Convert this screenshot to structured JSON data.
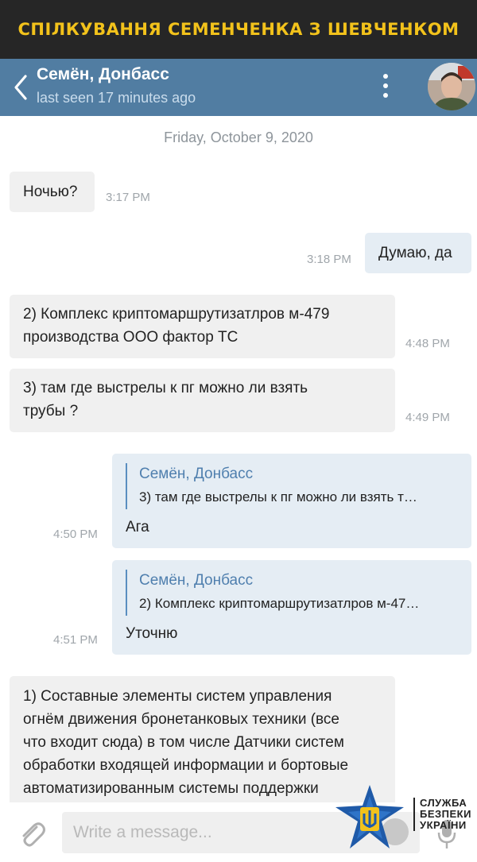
{
  "banner": {
    "title": "СПІЛКУВАННЯ СЕМЕНЧЕНКА З ШЕВЧЕНКОМ"
  },
  "header": {
    "chat_name": "Семён, Донбасс",
    "status": "last seen 17 minutes ago",
    "back_icon": "chevron-left-icon",
    "menu_icon": "more-vertical-icon"
  },
  "date_separator": "Friday, October 9, 2020",
  "messages": [
    {
      "text": "Ночью?",
      "time": "3:17 PM",
      "direction": "in"
    },
    {
      "text": "Думаю, да",
      "time": "3:18 PM",
      "direction": "out"
    },
    {
      "lines": [
        "2) Комплекс криптомаршрутизатлров м-479",
        "производства  ООО фактор ТС"
      ],
      "time": "4:48 PM",
      "direction": "in"
    },
    {
      "lines": [
        "3) там где выстрелы к пг можно ли взять",
        "трубы ?"
      ],
      "time": "4:49 PM",
      "direction": "in"
    },
    {
      "quote_name": "Семён, Донбасс",
      "quote_text": "3) там где выстрелы к пг можно ли взять т…",
      "text": "Ага",
      "time": "4:50 PM",
      "direction": "out"
    },
    {
      "quote_name": "Семён, Донбасс",
      "quote_text": "2) Комплекс криптомаршрутизатлров м-47…",
      "text": "Уточню",
      "time": "4:51 PM",
      "direction": "out"
    },
    {
      "lines": [
        "1) Составные элементы систем управления",
        "огнём движения бронетанковых техники (все",
        "что входит сюда) в том числе Датчики систем",
        "обработки входящей информации и бортовые",
        "автоматизированным системы поддержки"
      ],
      "direction": "in"
    }
  ],
  "input": {
    "placeholder": "Write a message..."
  },
  "watermark": {
    "lines": [
      "СЛУЖБА",
      "БЕЗПЕКИ",
      "УКРАЇНИ"
    ]
  },
  "colors": {
    "banner_bg": "#262626",
    "banner_text": "#f2c21b",
    "header_bg": "#517da2",
    "incoming_bubble": "#f0f0f0",
    "outgoing_bubble": "#e5edf4",
    "quote_accent": "#4f7fae"
  }
}
